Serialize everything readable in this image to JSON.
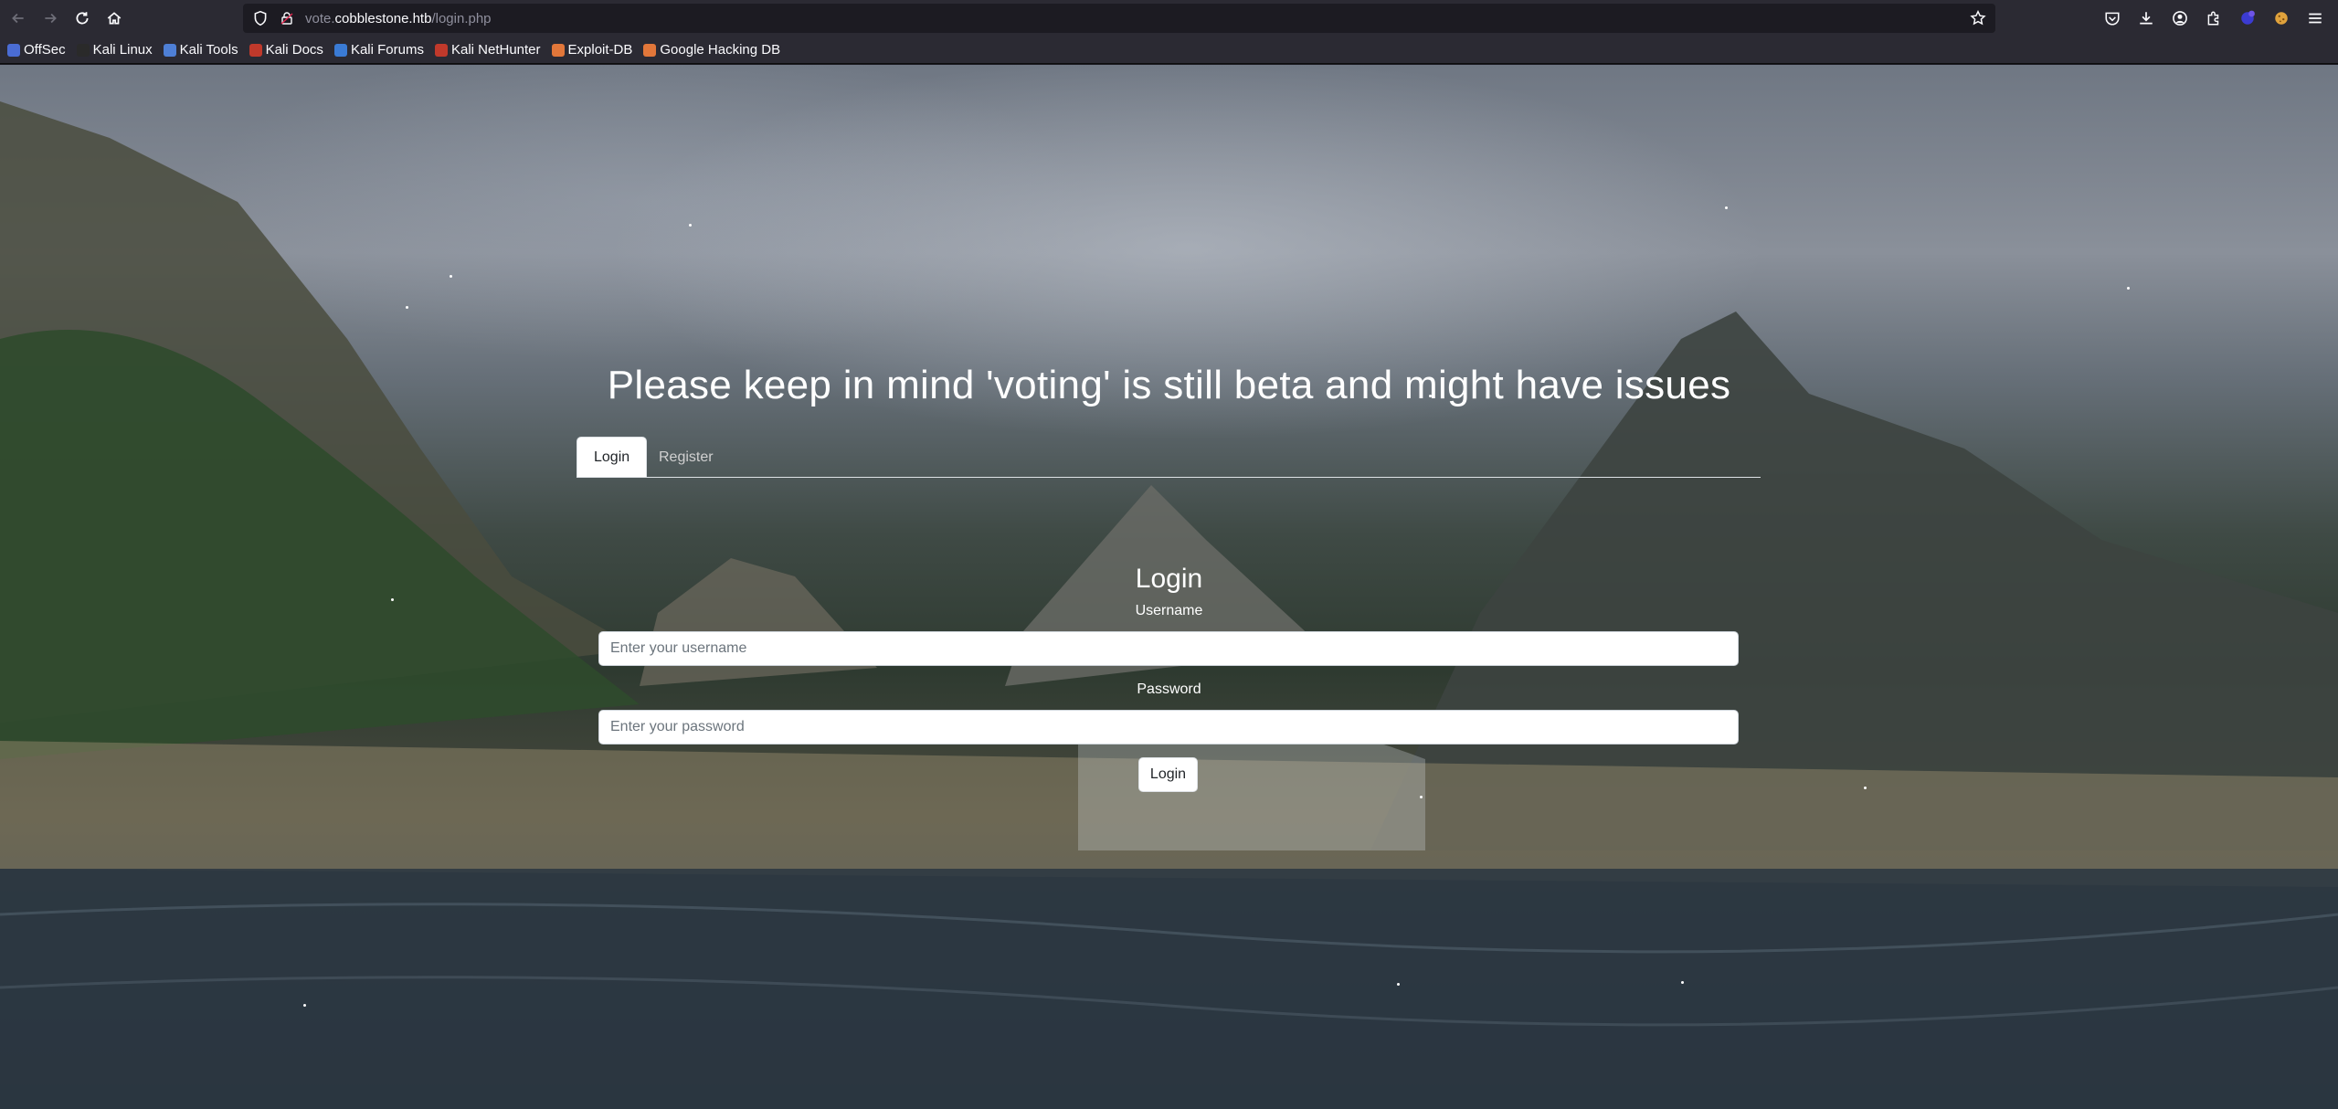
{
  "browser": {
    "url_prefix": "vote.",
    "url_domain": "cobblestone.htb",
    "url_path": "/login.php",
    "bookmarks": [
      {
        "label": "OffSec",
        "icon": "offsec-icon",
        "color": "#4a6cd4"
      },
      {
        "label": "Kali Linux",
        "icon": "kali-icon",
        "color": "#2a2a2a"
      },
      {
        "label": "Kali Tools",
        "icon": "kali-tools-icon",
        "color": "#4e7fd6"
      },
      {
        "label": "Kali Docs",
        "icon": "kali-docs-icon",
        "color": "#c0392b"
      },
      {
        "label": "Kali Forums",
        "icon": "kali-forums-icon",
        "color": "#3a7bd5"
      },
      {
        "label": "Kali NetHunter",
        "icon": "nethunter-icon",
        "color": "#c0392b"
      },
      {
        "label": "Exploit-DB",
        "icon": "exploitdb-icon",
        "color": "#e2773a"
      },
      {
        "label": "Google Hacking DB",
        "icon": "ghdb-icon",
        "color": "#e2773a"
      }
    ]
  },
  "page": {
    "headline": "Please keep in mind 'voting' is still beta and might have issues",
    "tabs": [
      {
        "label": "Login",
        "active": true
      },
      {
        "label": "Register",
        "active": false
      }
    ],
    "form": {
      "title": "Login",
      "username_label": "Username",
      "username_placeholder": "Enter your username",
      "password_label": "Password",
      "password_placeholder": "Enter your password",
      "submit_label": "Login"
    }
  }
}
